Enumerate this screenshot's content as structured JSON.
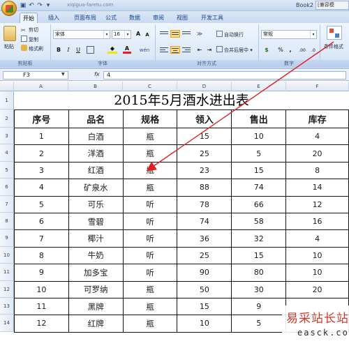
{
  "titlebar": {
    "url_text": "xiqigua-faretu.com",
    "book_title": "Book2",
    "compat_tag": "[兼容模"
  },
  "tabs": [
    "开始",
    "插入",
    "页面布局",
    "公式",
    "数据",
    "审阅",
    "视图",
    "开发工具"
  ],
  "ribbon": {
    "clipboard": {
      "paste": "粘贴",
      "cut": "剪切",
      "copy": "复制",
      "format_painter": "格式刷",
      "label": "剪贴板"
    },
    "font": {
      "name": "宋体",
      "size": "16",
      "grow": "A",
      "shrink": "A",
      "bold": "B",
      "italic": "I",
      "underline": "U",
      "font_color": "A",
      "phonetic": "wén",
      "label": "字体"
    },
    "alignment": {
      "wrap_text": "自动换行",
      "merge_center": "合并后居中",
      "label": "对齐方式"
    },
    "number": {
      "format": "常规",
      "currency": "$",
      "percent": "%",
      "comma": ",",
      "label": "数字"
    },
    "styles": {
      "conditional": "条件格式"
    }
  },
  "formula_bar": {
    "name_box": "F3",
    "fx": "fx",
    "value": "4"
  },
  "sheet": {
    "columns": [
      "A",
      "B",
      "C",
      "D",
      "E",
      "F"
    ],
    "rows": [
      "1",
      "2",
      "3",
      "4",
      "5",
      "6",
      "7",
      "8",
      "9",
      "10",
      "11",
      "12",
      "13",
      "14"
    ],
    "title": "2015年5月酒水进出表",
    "headers": [
      "序号",
      "品名",
      "规格",
      "领入",
      "售出",
      "库存"
    ],
    "data": [
      [
        "1",
        "白酒",
        "瓶",
        "15",
        "10",
        "4"
      ],
      [
        "2",
        "洋酒",
        "瓶",
        "25",
        "5",
        "20"
      ],
      [
        "3",
        "红酒",
        "瓶",
        "23",
        "15",
        "8"
      ],
      [
        "4",
        "矿泉水",
        "瓶",
        "88",
        "74",
        "14"
      ],
      [
        "5",
        "可乐",
        "听",
        "78",
        "66",
        "12"
      ],
      [
        "6",
        "雪碧",
        "听",
        "74",
        "58",
        "16"
      ],
      [
        "7",
        "椰汁",
        "听",
        "36",
        "32",
        "4"
      ],
      [
        "8",
        "牛奶",
        "听",
        "25",
        "15",
        "10"
      ],
      [
        "9",
        "加多宝",
        "听",
        "90",
        "80",
        "10"
      ],
      [
        "10",
        "可罗纳",
        "瓶",
        "50",
        "30",
        "20"
      ],
      [
        "11",
        "黑牌",
        "瓶",
        "15",
        "9",
        ""
      ],
      [
        "12",
        "红牌",
        "瓶",
        "10",
        "5",
        ""
      ]
    ]
  },
  "watermark": {
    "main": "易采站长站",
    "sub": "easck.com"
  },
  "colors": {
    "arrow": "#e02020",
    "ribbon_text": "#15428b",
    "watermark": "#d23a2a"
  }
}
